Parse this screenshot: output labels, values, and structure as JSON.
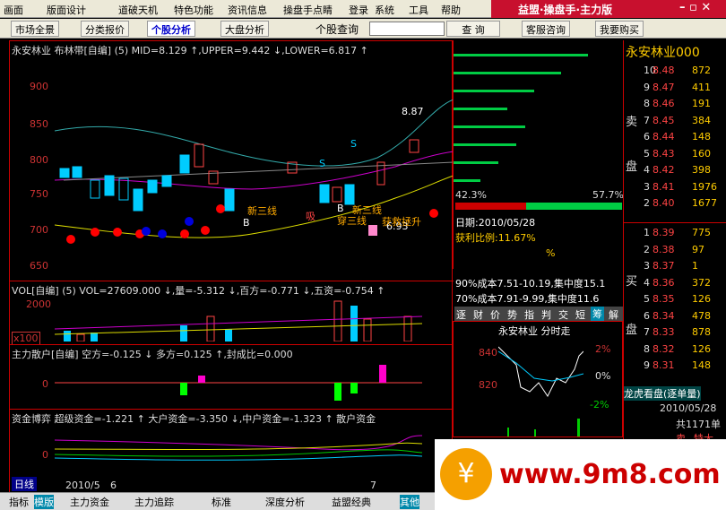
{
  "menu": [
    "画面",
    "版面设计",
    "道破天机",
    "特色功能",
    "资讯信息",
    "操盘手点睛",
    "登录",
    "系统",
    "工具",
    "帮助"
  ],
  "brand": "益盟·操盘手·主力版",
  "toolbar": {
    "market": "市场全景",
    "quote": "分类报价",
    "stock": "个股分析",
    "index": "大盘分析",
    "search_label": "个股查询",
    "search_btn": "查 询",
    "service": "客服咨询",
    "buy": "我要购买"
  },
  "main": {
    "title": "永安林业  布林带[自编] (5)  MID=8.129 ↑,UPPER=9.442 ↓,LOWER=6.817 ↑",
    "ylabels": [
      "900",
      "850",
      "800",
      "750",
      "700",
      "650"
    ],
    "annot": {
      "high": "8.87",
      "low": "6.93",
      "s1": "S",
      "s2": "S",
      "b1": "B",
      "b2": "B",
      "t1": "新三线",
      "t2": "吸",
      "t3": "穿三线",
      "t4": "新三线",
      "t5": "获救拯升"
    },
    "vol_title": "VOL[自编] (5)  VOL=27609.000 ↓,量=-5.312 ↓,百方=-0.771 ↓,五资=-0.754 ↑",
    "vol_y": "2000",
    "vol_x": "x100",
    "force_title": "主力散户[自编]  空方=-0.125 ↓ 多方=0.125 ↑,封成比=0.000",
    "force_y": "0",
    "game_title": "资金博弈  超级资金=-1.221 ↑ 大户资金=-3.350 ↓,中户资金=-1.323 ↑ 散户资金",
    "game_y": "0",
    "period": "日线",
    "date1": "2010/5",
    "date2": "6",
    "date3": "7"
  },
  "profile": {
    "pct1": "42.3%",
    "pct2": "57.7%",
    "date": "日期:2010/05/28",
    "ratio": "获利比例:11.67%",
    "pct": "%",
    "cost90": "90%成本7.51-10.19,集中度15.1",
    "cost70": "70%成本7.91-9.99,集中度11.6",
    "tabs": [
      "逐",
      "财",
      "价",
      "势",
      "指",
      "判",
      "交",
      "短",
      "筹",
      "解"
    ]
  },
  "mini": {
    "title": "永安林业  分时走",
    "y1": "840",
    "y2": "820",
    "p1": "2%",
    "p2": "0%",
    "p3": "-2%"
  },
  "quote": {
    "name": "永安林业000",
    "sell_label": "卖",
    "sell_label2": "盘",
    "buy_label": "买",
    "buy_label2": "盘",
    "sell": [
      [
        "10",
        "8.48",
        "872"
      ],
      [
        "9",
        "8.47",
        "411"
      ],
      [
        "8",
        "8.46",
        "191"
      ],
      [
        "7",
        "8.45",
        "384"
      ],
      [
        "6",
        "8.44",
        "148"
      ],
      [
        "5",
        "8.43",
        "160"
      ],
      [
        "4",
        "8.42",
        "398"
      ],
      [
        "3",
        "8.41",
        "1976"
      ],
      [
        "2",
        "8.40",
        "1677"
      ]
    ],
    "buy": [
      [
        "1",
        "8.39",
        "775"
      ],
      [
        "2",
        "8.38",
        "97"
      ],
      [
        "3",
        "8.37",
        "1"
      ],
      [
        "4",
        "8.36",
        "372"
      ],
      [
        "5",
        "8.35",
        "126"
      ],
      [
        "6",
        "8.34",
        "478"
      ],
      [
        "7",
        "8.33",
        "878"
      ],
      [
        "8",
        "8.32",
        "126"
      ],
      [
        "9",
        "8.31",
        "148"
      ]
    ],
    "dragon": "龙虎看盘(逐单量)",
    "date": "2010/05/28",
    "total": "共1171单",
    "bottom1": "卖",
    "bottom2": "特大"
  },
  "tabs": [
    "指标",
    "模版",
    "主力资金",
    "主力追踪",
    "标准",
    "深度分析",
    "益盟经典",
    "其他"
  ],
  "watermark": "www.9m8.com",
  "chart_data": {
    "type": "candlestick",
    "ylim": [
      625,
      950
    ]
  }
}
